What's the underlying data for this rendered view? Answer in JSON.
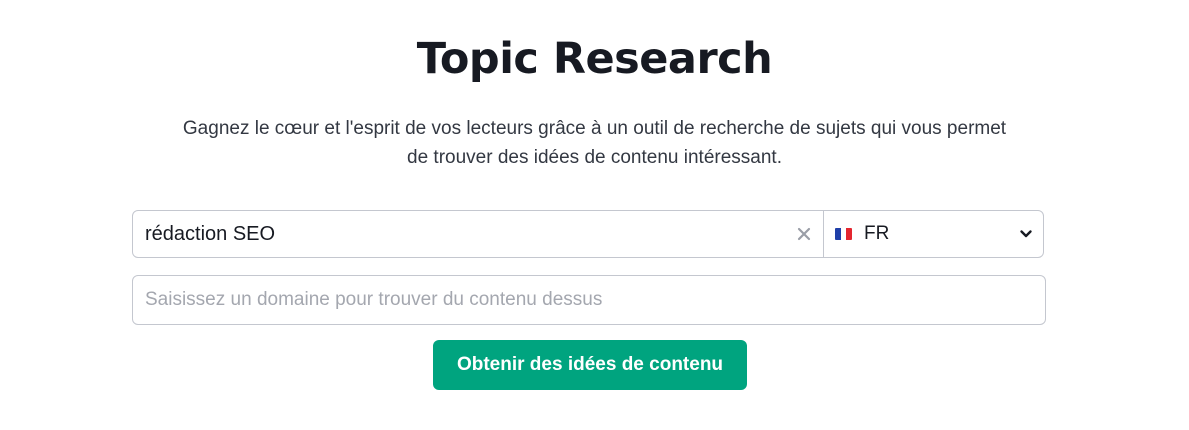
{
  "header": {
    "title": "Topic Research",
    "subtitle": "Gagnez le cœur et l'esprit de vos lecteurs grâce à un outil de recherche de sujets qui vous permet de trouver des idées de contenu intéressant."
  },
  "search": {
    "keyword_value": "rédaction SEO",
    "clear_icon": "close-icon",
    "database": {
      "flag_icon": "france-flag-icon",
      "label": "FR",
      "chevron_icon": "chevron-down-icon"
    },
    "domain_placeholder": "Saisissez un domaine pour trouver du contenu dessus",
    "domain_value": ""
  },
  "actions": {
    "submit_label": "Obtenir des idées de contenu"
  },
  "colors": {
    "accent": "#00a47f",
    "border": "#c4c7cf",
    "text": "#171a22"
  }
}
